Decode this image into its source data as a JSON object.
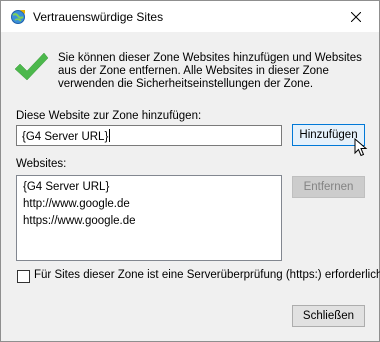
{
  "window": {
    "title": "Vertrauenswürdige Sites"
  },
  "info": {
    "text": "Sie können dieser Zone Websites hinzufügen und Websites aus der Zone entfernen. Alle Websites in dieser Zone verwenden die Sicherheitseinstellungen der Zone."
  },
  "add_site": {
    "label": "Diese Website zur Zone hinzufügen:",
    "value": "{G4 Server URL}",
    "add_button": "Hinzufügen"
  },
  "websites": {
    "label": "Websites:",
    "items": [
      "{G4 Server URL}",
      "http://www.google.de",
      "https://www.google.de"
    ],
    "remove_button": "Entfernen"
  },
  "https_check": {
    "label": "Für Sites dieser Zone ist eine Serverüberprüfung (https:) erforderlich",
    "checked": false
  },
  "footer": {
    "close_button": "Schließen"
  },
  "icons": {
    "title": "internet-options-icon",
    "success": "green-check-icon",
    "close": "close-icon"
  },
  "colors": {
    "check_green": "#4cb84c",
    "focus_blue": "#0078d7"
  }
}
